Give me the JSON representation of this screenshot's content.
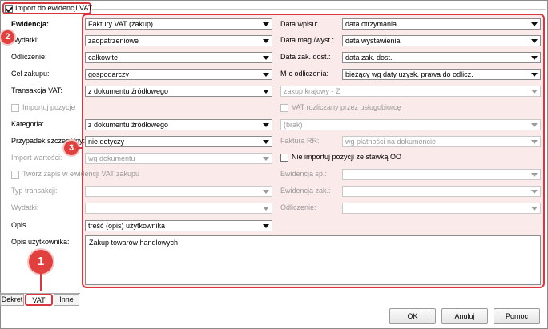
{
  "header": {
    "import_checkbox_label": "Import do ewidencji VAT",
    "import_checked": true
  },
  "left": {
    "ewidencja": {
      "label": "Ewidencja:",
      "value": "Faktury VAT (zakup)"
    },
    "wydatki": {
      "label": "Wydatki:",
      "value": "zaopatrzeniowe"
    },
    "odliczenie": {
      "label": "Odliczenie:",
      "value": "całkowite"
    },
    "cel_zakupu": {
      "label": "Cel zakupu:",
      "value": "gospodarczy"
    },
    "transakcja_vat": {
      "label": "Transakcja VAT:",
      "value": "z dokumentu źródłowego"
    },
    "importuj_pozycje": {
      "label": "Importuj pozycje"
    },
    "kategoria": {
      "label": "Kategoria:",
      "value": "z dokumentu źródłowego"
    },
    "przypadek": {
      "label": "Przypadek szczególny:",
      "value": "nie dotyczy"
    },
    "import_wartosci": {
      "label": "Import wartości:",
      "value": "wg dokumentu"
    },
    "tworz_zapis": {
      "label": "Twórz zapis w ewidencji VAT zakupu"
    },
    "typ_transakcji": {
      "label": "Typ transakcji:",
      "value": ""
    },
    "wydatki2": {
      "label": "Wydatki:",
      "value": ""
    },
    "opis": {
      "label": "Opis",
      "value": "treść (opis) użytkownika"
    },
    "opis_uzytkownika": {
      "label": "Opis użytkownika:",
      "value": "Zakup towarów handlowych"
    }
  },
  "right": {
    "data_wpisu": {
      "label": "Data wpisu:",
      "value": "data otrzymania"
    },
    "data_mag": {
      "label": "Data mag./wyst.:",
      "value": "data wystawienia"
    },
    "data_zak": {
      "label": "Data zak. dost.:",
      "value": "data zak. dost."
    },
    "mc_odliczenia": {
      "label": "M-c odliczenia:",
      "value": "bieżący wg daty uzysk. prawa do odlicz."
    },
    "zakup_krajowy": {
      "value": "zakup krajowy - Z"
    },
    "vat_rozliczany": {
      "label": "VAT rozliczany przez usługobiorcę"
    },
    "brak": {
      "value": "(brak)"
    },
    "faktura_rr": {
      "label": "Faktura RR:",
      "value": "wg płatności na dokumencie"
    },
    "nie_importuj": {
      "label": "Nie importuj pozycji ze stawką OO"
    },
    "ewidencja_sp": {
      "label": "Ewidencja sp.:",
      "value": ""
    },
    "ewidencja_zak": {
      "label": "Ewidencja zak.:",
      "value": ""
    },
    "odliczenie2": {
      "label": "Odliczenie:",
      "value": ""
    }
  },
  "tabs": [
    "Dekret",
    "VAT",
    "Inne"
  ],
  "buttons": {
    "ok": "OK",
    "cancel": "Anuluj",
    "help": "Pomoc"
  },
  "annotations": [
    "1",
    "2",
    "3"
  ],
  "colors": {
    "highlight": "#d9373f",
    "field_bg": "#fbeaea"
  }
}
